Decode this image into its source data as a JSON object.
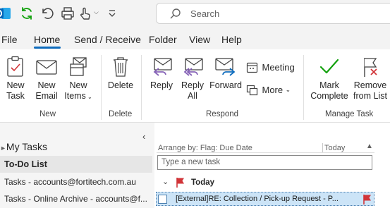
{
  "titlebar": {
    "search_placeholder": "Search",
    "quick_access": [
      "outlook-app-icon",
      "sync-icon",
      "undo-icon",
      "print-icon",
      "touch-mode-icon",
      "customize-quick-access-icon"
    ]
  },
  "menu": {
    "file": "File",
    "home": "Home",
    "send_receive": "Send / Receive",
    "folder": "Folder",
    "view": "View",
    "help": "Help"
  },
  "ribbon": {
    "new_task": [
      "New",
      "Task"
    ],
    "new_email": [
      "New",
      "Email"
    ],
    "new_items": [
      "New",
      "Items"
    ],
    "group_new": "New",
    "delete": "Delete",
    "group_delete": "Delete",
    "reply": "Reply",
    "reply_all": [
      "Reply",
      "All"
    ],
    "forward": "Forward",
    "meeting": "Meeting",
    "more": "More",
    "group_respond": "Respond",
    "mark_complete": [
      "Mark",
      "Complete"
    ],
    "remove_from_list": [
      "Remove",
      "from List"
    ],
    "group_manage_task": "Manage Task"
  },
  "nav": {
    "header": "My Tasks",
    "items": [
      "To-Do List",
      "Tasks - accounts@fortitech.com.au",
      "Tasks - Online Archive - accounts@f..."
    ]
  },
  "tasklist": {
    "arrange_by": "Arrange by: Flag: Due Date",
    "sort_label": "Today",
    "new_task_placeholder": "Type a new task",
    "group_today": "Today",
    "tasks": [
      {
        "subject": "[External]RE: Collection / Pick-up Request - P..."
      }
    ]
  },
  "colors": {
    "accent": "#0f6cbd",
    "flag_red": "#d13438",
    "complete_green": "#13a10e",
    "reply_purple": "#8764b8",
    "selection": "#cce4f7",
    "nav_selected": "#e6e6e6"
  }
}
